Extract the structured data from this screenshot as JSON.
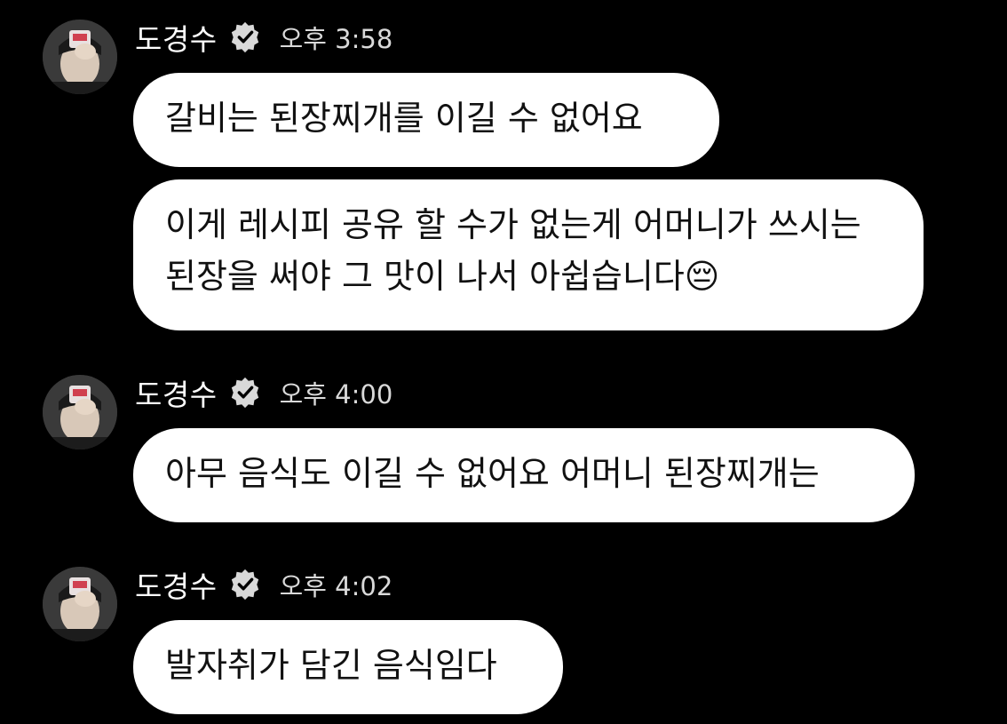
{
  "messages_groups": [
    {
      "sender": "도경수",
      "time": "오후 3:58",
      "bubbles": [
        "갈비는 된장찌개를 이길 수 없어요",
        "이게 레시피 공유 할 수가 없는게 어머니가 쓰시는 된장을 써야 그 맛이 나서 아쉽습니다😔"
      ]
    },
    {
      "sender": "도경수",
      "time": "오후 4:00",
      "bubbles": [
        "아무 음식도 이길 수 없어요 어머니 된장찌개는"
      ]
    },
    {
      "sender": "도경수",
      "time": "오후 4:02",
      "bubbles": [
        "발자취가 담긴 음식임다"
      ]
    }
  ],
  "icons": {
    "verified": "verified-badge-icon",
    "avatar": "profile-avatar"
  },
  "colors": {
    "background": "#000000",
    "bubble": "#ffffff",
    "name": "#ffffff",
    "time": "#d9d9d9"
  }
}
